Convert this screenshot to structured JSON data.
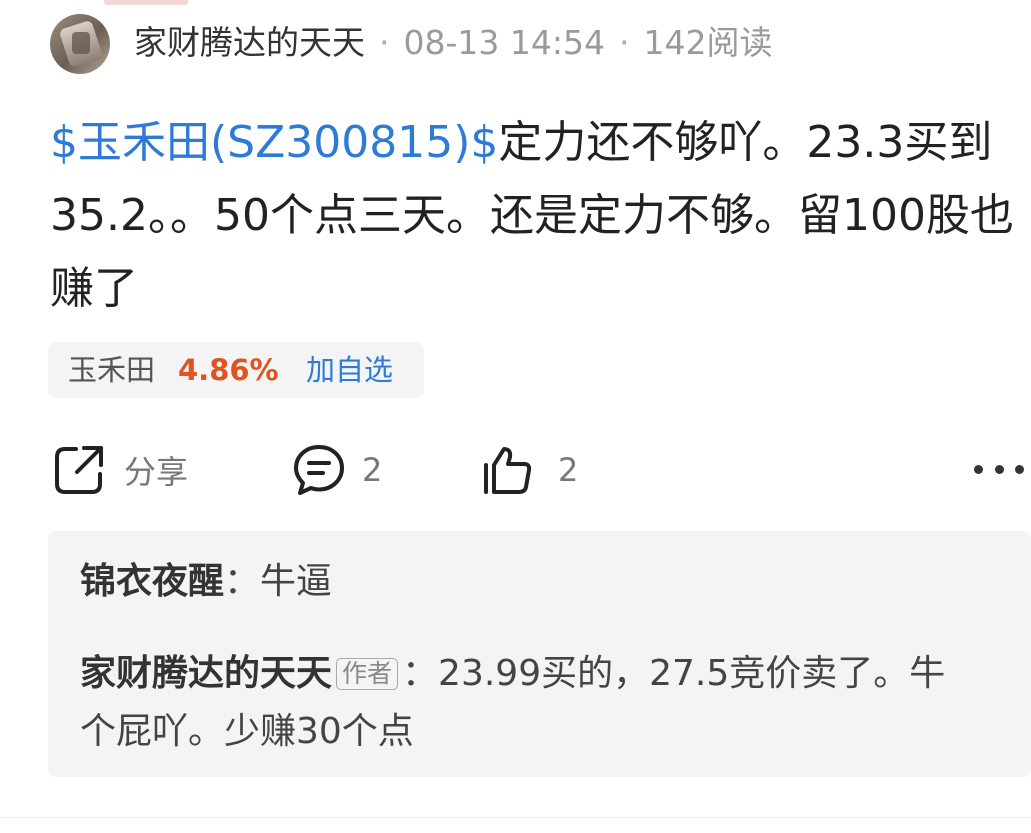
{
  "post": {
    "author": "家财腾达的天天",
    "date": "08-13 14:54",
    "reads": "142阅读",
    "content_link": "$玉禾田(SZ300815)$",
    "content_text": "定力还不够吖。23.3买到35.2。。50个点三天。还是定力不够。留100股也赚了"
  },
  "stock_chip": {
    "name": "玉禾田",
    "change": "4.86%",
    "add_label": "加自选",
    "change_color": "#e0541f"
  },
  "actions": {
    "share_label": "分享",
    "comment_count": "2",
    "like_count": "2",
    "icons": [
      "share-icon",
      "comment-icon",
      "like-icon",
      "more-icon"
    ]
  },
  "replies": [
    {
      "user": "锦衣夜醒",
      "separator": "：",
      "text": "牛逼"
    },
    {
      "user": "家财腾达的天天",
      "tag": "作者",
      "separator": "：",
      "text": "23.99买的，27.5竞价卖了。牛个屁吖。少赚30个点"
    }
  ],
  "colors": {
    "link": "#2d7bd6",
    "chip_bg": "#f4f4f6",
    "replies_bg": "#f4f4f6"
  }
}
